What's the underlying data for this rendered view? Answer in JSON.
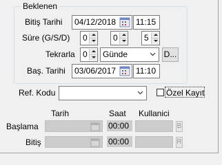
{
  "group": {
    "legend": "Beklenen",
    "end_date_label": "Bitiş Tarihi",
    "end_date_value": "04/12/2018",
    "end_time_value": "11:15",
    "duration_label": "Süre (G/S/D)",
    "duration_days": "0",
    "duration_hours": "0",
    "duration_minutes": "5",
    "repeat_label": "Tekrarla",
    "repeat_count": "0",
    "repeat_unit": "Günde",
    "repeat_more_button": "D...",
    "start_date_label": "Baş. Tarihi",
    "start_date_value": "03/06/2017",
    "start_time_value": "11:10"
  },
  "ref": {
    "label": "Ref. Kodu",
    "value": "",
    "private_label": "Özel Kayıt"
  },
  "table": {
    "col_date": "Tarih",
    "col_time": "Saat",
    "col_user": "Kullanici",
    "rows": [
      {
        "label": "Başlama",
        "date": "",
        "time": "00:00",
        "user": "",
        "button": "B"
      },
      {
        "label": "Bitiş",
        "date": "",
        "time": "00:00",
        "user": "",
        "button": "R"
      }
    ]
  }
}
